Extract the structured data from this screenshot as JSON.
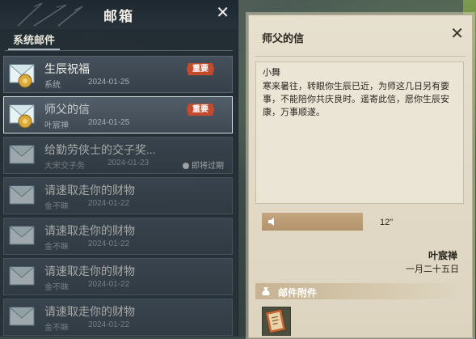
{
  "mailbox": {
    "title": "邮箱",
    "tab_label": "系统邮件",
    "items": [
      {
        "title": "生辰祝福",
        "sender": "系统",
        "date": "2024-01-25",
        "badge": "重要",
        "status": ""
      },
      {
        "title": "师父的信",
        "sender": "叶宸禅",
        "date": "2024-01-25",
        "badge": "重要",
        "status": ""
      },
      {
        "title": "给勤劳侠士的交子奖...",
        "sender": "大宋交子务",
        "date": "2024-01-23",
        "badge": "",
        "status": "即将过期"
      },
      {
        "title": "请速取走你的财物",
        "sender": "金不眛",
        "date": "2024-01-22",
        "badge": "",
        "status": ""
      },
      {
        "title": "请速取走你的财物",
        "sender": "金不眛",
        "date": "2024-01-22",
        "badge": "",
        "status": ""
      },
      {
        "title": "请速取走你的财物",
        "sender": "金不眛",
        "date": "2024-01-22",
        "badge": "",
        "status": ""
      },
      {
        "title": "请速取走你的财物",
        "sender": "金不眛",
        "date": "2024-01-22",
        "badge": "",
        "status": ""
      }
    ]
  },
  "letter": {
    "title": "师父的信",
    "greeting": "小舞",
    "body": "寒来暑往，转眼你生辰已近，为师这几日另有要事，不能陪你共庆良时。遥寄此信，愿你生辰安康，万事顺遂。",
    "voice_duration": "12\"",
    "signature": "叶宸禅",
    "signature_date": "一月二十五日",
    "attachments_label": "邮件附件"
  },
  "colors": {
    "badge": "#c34a2c",
    "panel_bg": "#263038",
    "paper": "#e7e0cf",
    "voice_bar": "#b99a72"
  }
}
